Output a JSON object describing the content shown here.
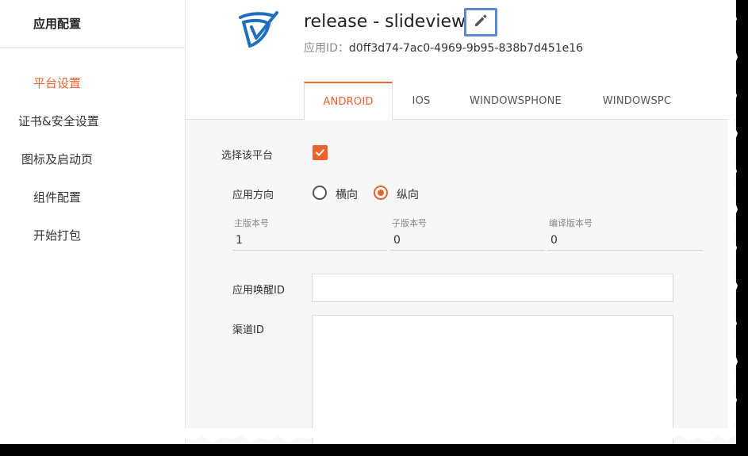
{
  "sidebar": {
    "header": "应用配置",
    "items": [
      {
        "label": "平台设置",
        "active": true
      },
      {
        "label": "证书&安全设置",
        "active": false
      },
      {
        "label": "图标及启动页",
        "active": false
      },
      {
        "label": "组件配置",
        "active": false
      },
      {
        "label": "开始打包",
        "active": false
      }
    ]
  },
  "app": {
    "title": "release - slideview",
    "id_label": "应用ID：",
    "id_value": "d0ff3d74-7ac0-4969-9b95-838b7d451e16",
    "logo_icon": "app-logo-icon",
    "edit_icon": "pencil-icon"
  },
  "tabs": [
    {
      "label": "ANDROID",
      "active": true
    },
    {
      "label": "IOS",
      "active": false
    },
    {
      "label": "WINDOWSPHONE",
      "active": false
    },
    {
      "label": "WINDOWSPC",
      "active": false
    }
  ],
  "form": {
    "select_platform_label": "选择该平台",
    "select_platform_checked": true,
    "orientation_label": "应用方向",
    "orientation_options": [
      {
        "label": "横向",
        "checked": false
      },
      {
        "label": "纵向",
        "checked": true
      }
    ],
    "versions": [
      {
        "caption": "主版本号",
        "value": "1"
      },
      {
        "caption": "子版本号",
        "value": "0"
      },
      {
        "caption": "编译版本号",
        "value": "0"
      }
    ],
    "wakeup_id_label": "应用唤醒ID",
    "wakeup_id_value": "",
    "channel_id_label": "渠道ID",
    "channel_id_value": ""
  },
  "colors": {
    "accent": "#e8642e",
    "edit_border": "#5e8ad2",
    "logo_blue": "#1f6fc0"
  }
}
